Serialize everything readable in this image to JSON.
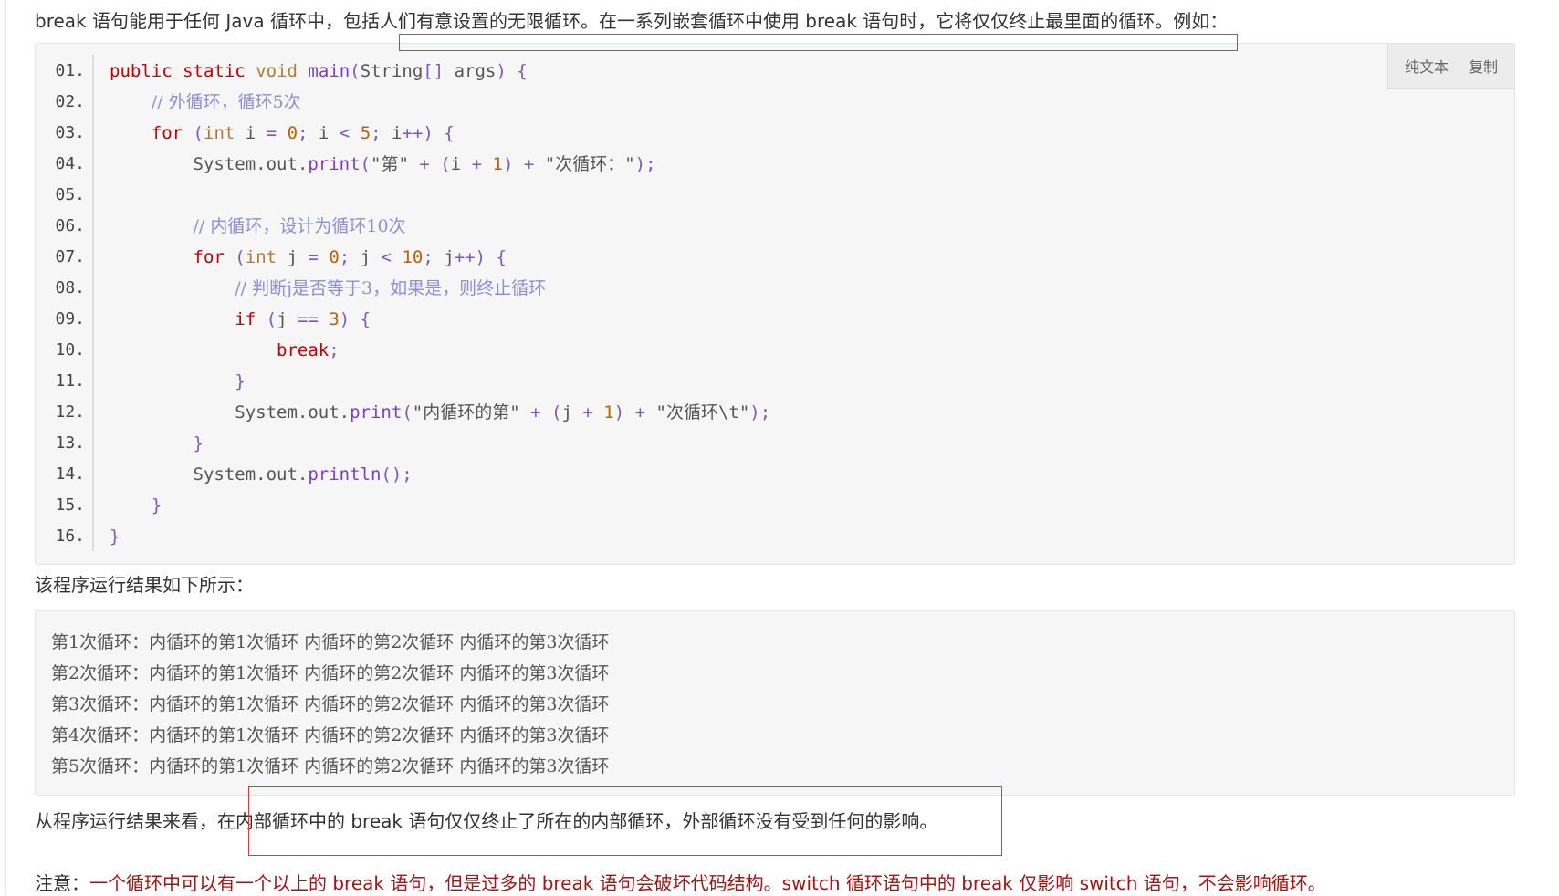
{
  "intro_text": "break 语句能用于任何 Java 循环中，包括人们有意设置的无限循环。在一系列嵌套循环中使用 break 语句时，它将仅仅终止最里面的循环。例如：",
  "toolbar": {
    "plain_text": "纯文本",
    "copy": "复制"
  },
  "code_lines": [
    {
      "n": "01.",
      "html": "<span class='kw'>public</span> <span class='kw'>static</span> <span class='ty'>void</span> <span class='fn'>main</span><span class='pu'>(</span>String<span class='pu'>[]</span> args<span class='pu'>)</span> <span class='pu'>{</span>"
    },
    {
      "n": "02.",
      "html": "    <span class='cm'>// 外循环，循环5次</span>"
    },
    {
      "n": "03.",
      "html": "    <span class='kw'>for</span> <span class='pu'>(</span><span class='ty'>int</span> i <span class='pu'>=</span> <span class='num'>0</span><span class='pu'>;</span> i <span class='pu'>&lt;</span> <span class='num'>5</span><span class='pu'>;</span> i<span class='pu'>++)</span> <span class='pu'>{</span>"
    },
    {
      "n": "04.",
      "html": "        System.out.<span class='fn'>print</span><span class='pu'>(</span><span class='st'>\"第\"</span> <span class='pu'>+</span> <span class='pu'>(</span>i <span class='pu'>+</span> <span class='num'>1</span><span class='pu'>)</span> <span class='pu'>+</span> <span class='st'>\"次循环：\"</span><span class='pu'>);</span>"
    },
    {
      "n": "05.",
      "html": ""
    },
    {
      "n": "06.",
      "html": "        <span class='cm'>// 内循环，设计为循环10次</span>"
    },
    {
      "n": "07.",
      "html": "        <span class='kw'>for</span> <span class='pu'>(</span><span class='ty'>int</span> j <span class='pu'>=</span> <span class='num'>0</span><span class='pu'>;</span> j <span class='pu'>&lt;</span> <span class='num'>10</span><span class='pu'>;</span> j<span class='pu'>++)</span> <span class='pu'>{</span>"
    },
    {
      "n": "08.",
      "html": "            <span class='cm'>// 判断j是否等于3，如果是，则终止循环</span>"
    },
    {
      "n": "09.",
      "html": "            <span class='kw'>if</span> <span class='pu'>(</span>j <span class='pu'>==</span> <span class='num'>3</span><span class='pu'>)</span> <span class='pu'>{</span>"
    },
    {
      "n": "10.",
      "html": "                <span class='kw'>break</span><span class='pu'>;</span>"
    },
    {
      "n": "11.",
      "html": "            <span class='pu'>}</span>"
    },
    {
      "n": "12.",
      "html": "            System.out.<span class='fn'>print</span><span class='pu'>(</span><span class='st'>\"内循环的第\"</span> <span class='pu'>+</span> <span class='pu'>(</span>j <span class='pu'>+</span> <span class='num'>1</span><span class='pu'>)</span> <span class='pu'>+</span> <span class='st'>\"次循环\\t\"</span><span class='pu'>);</span>"
    },
    {
      "n": "13.",
      "html": "        <span class='pu'>}</span>"
    },
    {
      "n": "14.",
      "html": "        System.out.<span class='fn'>println</span><span class='pu'>();</span>"
    },
    {
      "n": "15.",
      "html": "    <span class='pu'>}</span>"
    },
    {
      "n": "16.",
      "html": "<span class='pu'>}</span>"
    }
  ],
  "result_label": "该程序运行结果如下所示：",
  "output_lines": [
    "第1次循环：内循环的第1次循环 内循环的第2次循环 内循环的第3次循环",
    "第2次循环：内循环的第1次循环 内循环的第2次循环 内循环的第3次循环",
    "第3次循环：内循环的第1次循环 内循环的第2次循环 内循环的第3次循环",
    "第4次循环：内循环的第1次循环 内循环的第2次循环 内循环的第3次循环",
    "第5次循环：内循环的第1次循环 内循环的第2次循环 内循环的第3次循环"
  ],
  "conclusion_text": "从程序运行结果来看，在内部循环中的 break 语句仅仅终止了所在的内部循环，外部循环没有受到任何的影响。",
  "note": {
    "label": "注意：",
    "text": "一个循环中可以有一个以上的 break 语句，但是过多的 break 语句会破坏代码结构。switch 循环语句中的 break 仅影响 switch 语句，不会影响循环。"
  },
  "colors": {
    "highlight_box": "#e33333",
    "note_text": "#a31515",
    "code_bg": "#f6f6f6"
  }
}
